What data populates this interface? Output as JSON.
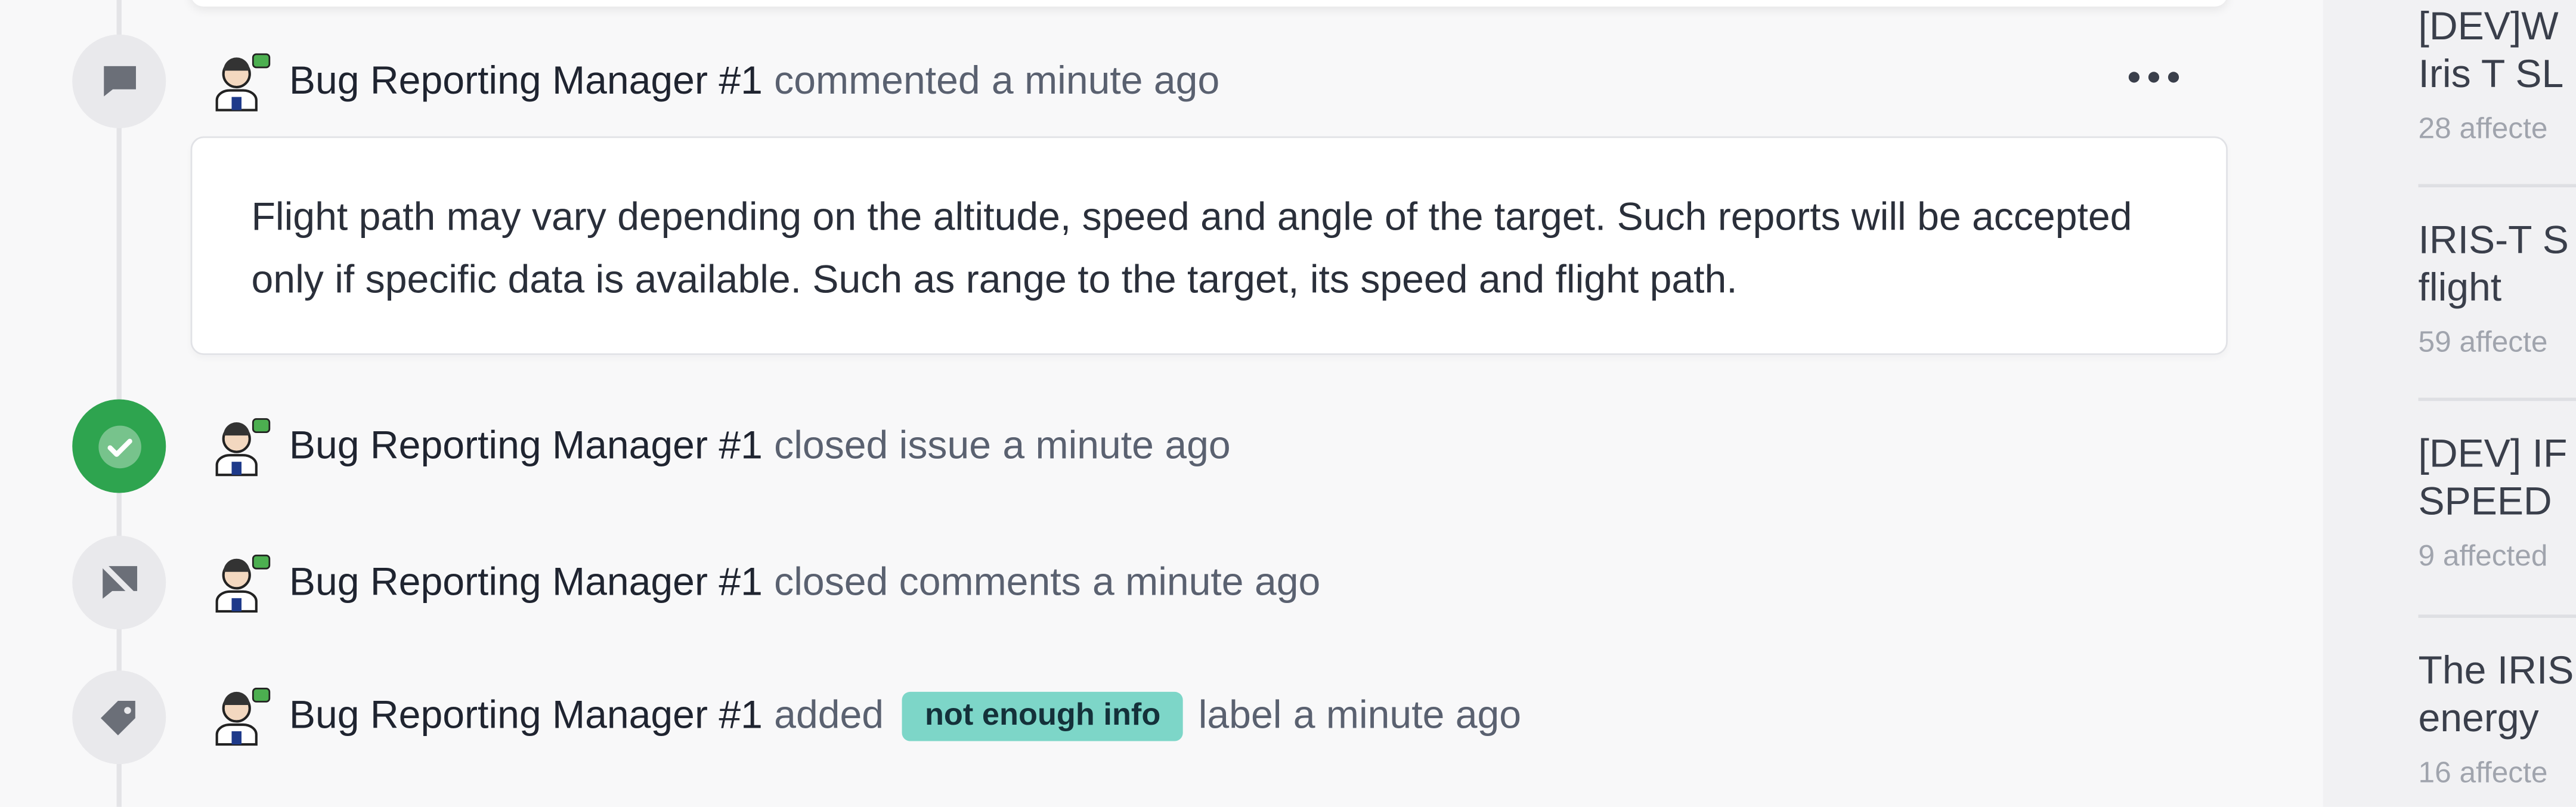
{
  "timeline": {
    "comment_event": {
      "actor": "Bug Reporting Manager #1",
      "action": "commented",
      "time": "a minute ago",
      "body": "Flight path may vary depending on the altitude, speed and angle of the target. Such reports will be accepted only if specific data is available. Such as range to the target, its speed and flight path.",
      "icon": "speech-bubble-icon",
      "more_icon": "ellipsis-icon"
    },
    "closed_issue_event": {
      "actor": "Bug Reporting Manager #1",
      "action": "closed issue",
      "time": "a minute ago",
      "icon": "check-circle-icon",
      "icon_color": "#2ea44f"
    },
    "closed_comments_event": {
      "actor": "Bug Reporting Manager #1",
      "action": "closed comments",
      "time": "a minute ago",
      "icon": "comment-disabled-icon"
    },
    "label_event": {
      "actor": "Bug Reporting Manager #1",
      "action": "added",
      "label": "not enough info",
      "label_color": "#7dd6c8",
      "suffix": "label",
      "time": "a minute ago",
      "icon": "tag-icon"
    }
  },
  "sidebar": {
    "items": [
      {
        "title_line1": "[DEV]W",
        "title_line2": "Iris T SL",
        "meta": "28 affecte"
      },
      {
        "title_line1": "IRIS-T S",
        "title_line2": "flight",
        "meta": "59 affecte"
      },
      {
        "title_line1": "[DEV] IF",
        "title_line2": "SPEED",
        "meta": "9 affected"
      },
      {
        "title_line1": "The IRIS",
        "title_line2": "energy",
        "meta": "16 affecte"
      }
    ]
  }
}
